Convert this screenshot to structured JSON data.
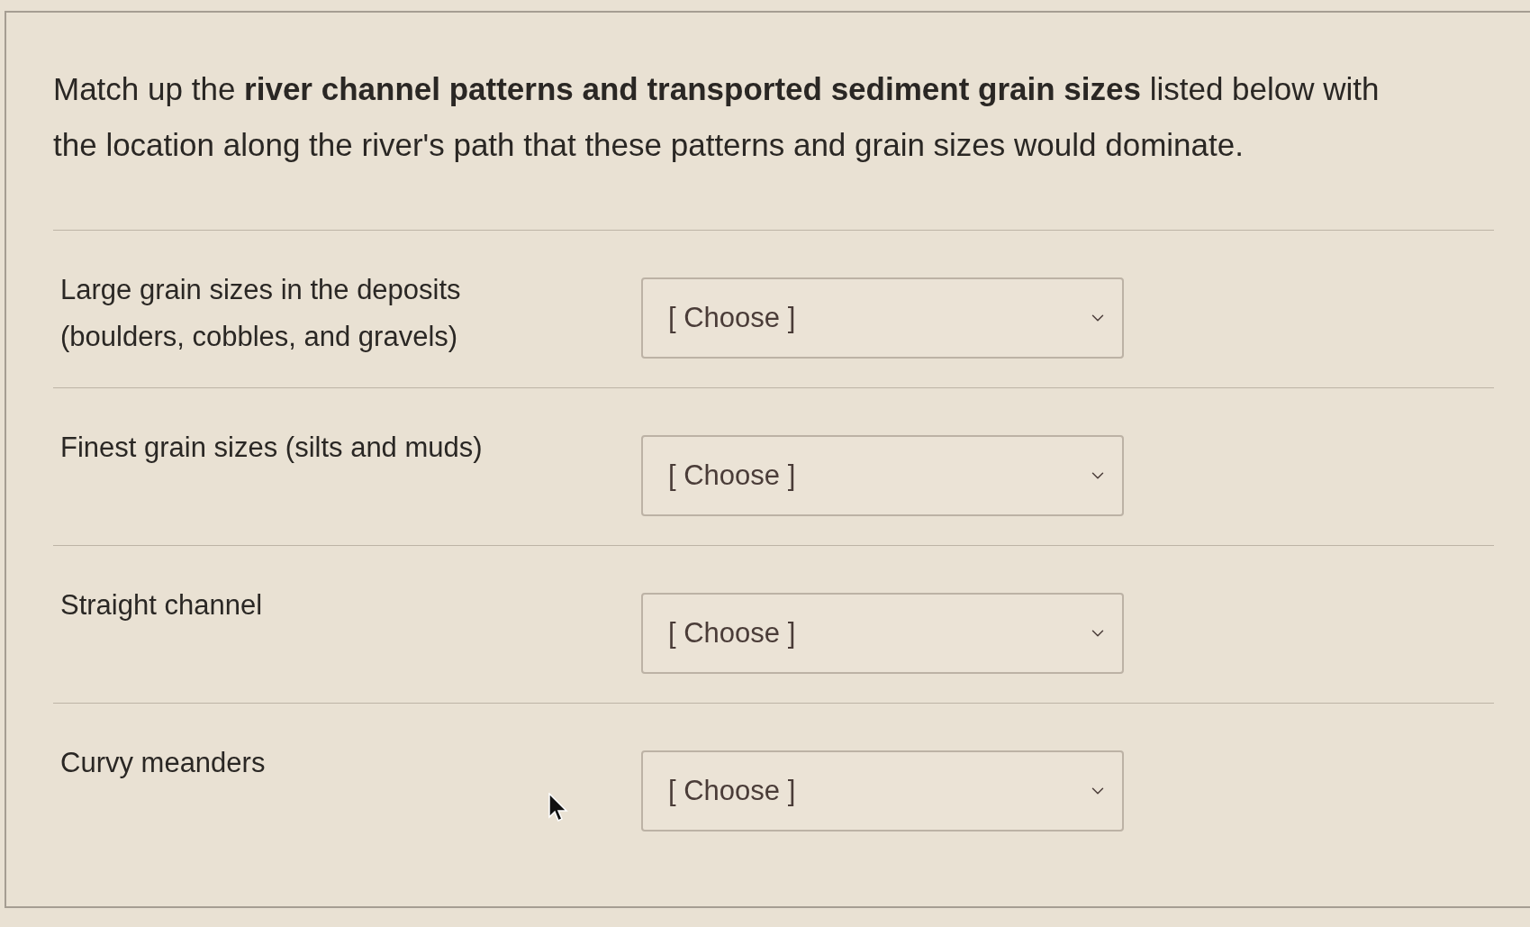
{
  "question": {
    "text": "Match up the **river channel patterns and transported sediment grain sizes** listed below with the location along the river's path that these patterns and grain sizes would dominate."
  },
  "matches": [
    {
      "label": "Large grain sizes in the deposits (boulders, cobbles, and gravels)",
      "dropdown": {
        "value": "[ Choose ]"
      }
    },
    {
      "label": "Finest grain sizes (silts and muds)",
      "dropdown": {
        "value": "[ Choose ]"
      }
    },
    {
      "label": "Straight channel",
      "dropdown": {
        "value": "[ Choose ]"
      }
    },
    {
      "label": "Curvy meanders",
      "dropdown": {
        "value": "[ Choose ]"
      }
    }
  ]
}
